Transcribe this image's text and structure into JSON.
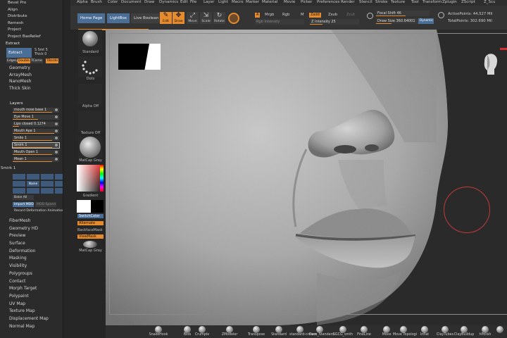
{
  "left_menu": {
    "top_items": [
      "Bevel Pro",
      "Align",
      "Distribute",
      "Remesh",
      "Project",
      "Project BasRelief"
    ],
    "extract_header": "Extract",
    "extract_button": "Extract",
    "s_smt": "S Smt 5",
    "thick": "Thick 0",
    "extract_toggles": [
      "EdgeLp",
      "Double",
      "TCorne",
      "TBorde"
    ],
    "subpalettes_1": [
      "Geometry",
      "ArrayMesh",
      "NanoMesh",
      "Thick Skin"
    ],
    "layers_header": "Layers",
    "layers": [
      {
        "name": "mouth nose base 1",
        "level": 0.85,
        "selected": false
      },
      {
        "name": "Eye Move 1",
        "level": 0.55,
        "selected": false
      },
      {
        "name": "Lips closed 0.1274",
        "level": 0.13,
        "selected": false
      },
      {
        "name": "Mouth Ape 1",
        "level": 0.9,
        "selected": false
      },
      {
        "name": "Smile 1",
        "level": 0.85,
        "selected": false
      },
      {
        "name": "Smirk 1",
        "level": 0.85,
        "selected": true
      },
      {
        "name": "Mouth Open 1",
        "level": 0.85,
        "selected": false
      },
      {
        "name": "Mean 1",
        "level": 0.85,
        "selected": false
      }
    ],
    "smirk_slider": "Smirk 1",
    "layer_btns_row1": [
      "",
      "",
      "",
      ""
    ],
    "layer_btns_row2": [
      "",
      "Name",
      "",
      ""
    ],
    "layer_btns_row3": [
      "",
      "",
      "",
      ""
    ],
    "bake_all": "Bake All",
    "import_mdd": "Import MDD",
    "mdd_speed": "MDD Speed",
    "record": "Record Deformation Animation",
    "subpalettes_2": [
      "FiberMesh",
      "Geometry HD",
      "Preview",
      "Surface",
      "Deformation",
      "Masking",
      "Visibility",
      "Polygroups",
      "Contact",
      "Morph Target",
      "Polypaint",
      "UV Map",
      "Texture Map",
      "Displacement Map",
      "Normal Map"
    ]
  },
  "menubar": [
    "Alpha",
    "Brush",
    "Color",
    "Document",
    "Draw",
    "Dynamics",
    "Edit",
    "File",
    "Layer",
    "Light",
    "Macro",
    "Marker",
    "Material",
    "Movie",
    "Picker",
    "Preferences",
    "Render",
    "Stencil",
    "Stroke",
    "Texture",
    "Tool",
    "Transform",
    "Zplugin",
    "ZScript",
    "Z_Scu"
  ],
  "shelf": {
    "home_page": "Home Page",
    "lightbox": "LightBox",
    "live_boolean": "Live Boolean",
    "edit": "Edit",
    "draw": "Draw",
    "move": "Move",
    "scale": "Scale",
    "rotate": "Rotate",
    "a_tag": "A",
    "mrgb": "Mrgb",
    "rgb": "Rgb",
    "m": "M",
    "zadd": "Zadd",
    "zsub": "Zsub",
    "zcut": "Zcut",
    "rgb_intensity": "Rgb Intensity",
    "z_intensity": "Z Intensity 25",
    "focal_shift": "Focal Shift 46",
    "draw_size": "Draw Size 360.64001",
    "dynamic": "Dynamic",
    "active_points": "ActivePoints: 44,527 Mil",
    "total_points": "TotalPoints: 302.690 Mil"
  },
  "materials": {
    "standard": "Standard",
    "dots": "Dots",
    "alpha_off": "Alpha Off",
    "texture_off": "Texture Off",
    "matcap_gray": "MatCap Gray",
    "gradient": "Gradient",
    "switch_color": "SwitchColor",
    "alternate": "Alternate",
    "backface_mask": "BackfaceMask",
    "viewmask": "ViewMask",
    "matcap_gray_2": "MatCap Gray"
  },
  "bottom_brushes": [
    "SnakeHook",
    "Blob",
    "Crumple",
    "ZModeler",
    "Transpose",
    "Standard",
    "standard-crease",
    "Dam_Standard",
    "SGCG_smth",
    "FineLine",
    "Move",
    "Move Topologi",
    "Inflat",
    "ClayTubes",
    "ClayBuildup",
    "hPolish",
    ""
  ],
  "colors": {
    "accent": "#e68a2e",
    "blue": "#4a6e96",
    "brush_circle": "#c23a3a"
  }
}
